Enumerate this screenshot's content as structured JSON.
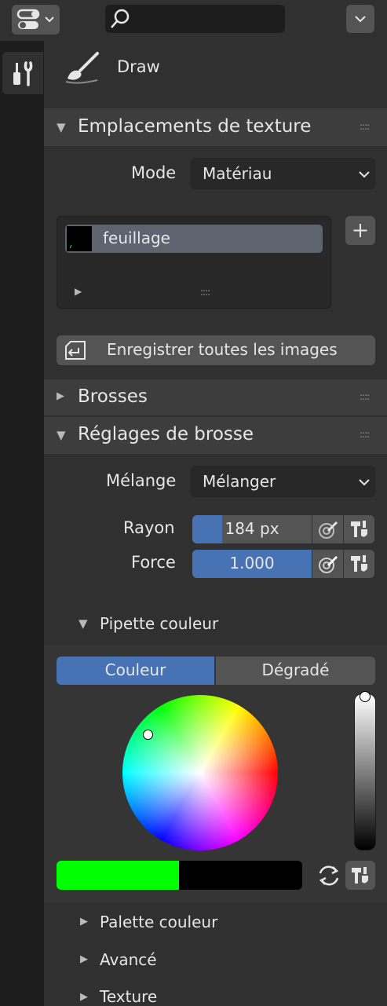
{
  "header": {
    "tool_name": "Draw"
  },
  "sections": {
    "texture_slots": {
      "title": "Emplacements de texture",
      "mode_label": "Mode",
      "mode_value": "Matériau",
      "slots": [
        {
          "name": "feuillage"
        }
      ],
      "save_all_label": "Enregistrer toutes les images"
    },
    "brushes": {
      "title": "Brosses"
    },
    "brush_settings": {
      "title": "Réglages de brosse",
      "blend_label": "Mélange",
      "blend_value": "Mélanger",
      "radius_label": "Rayon",
      "radius_value": "184 px",
      "radius_fill": 0.25,
      "strength_label": "Force",
      "strength_value": "1.000",
      "strength_fill": 1.0
    },
    "color_picker": {
      "title": "Pipette couleur",
      "tabs": [
        "Couleur",
        "Dégradé"
      ],
      "active_tab": "Couleur",
      "primary_color": "#00ff00",
      "secondary_color": "#000000",
      "value_level": 1.0
    },
    "collapsed": [
      {
        "title": "Palette couleur"
      },
      {
        "title": "Avancé"
      },
      {
        "title": "Texture"
      }
    ]
  },
  "colors": {
    "accent": "#4772b3",
    "panel_bg": "#303030",
    "header_bg": "#3d3d3d"
  }
}
